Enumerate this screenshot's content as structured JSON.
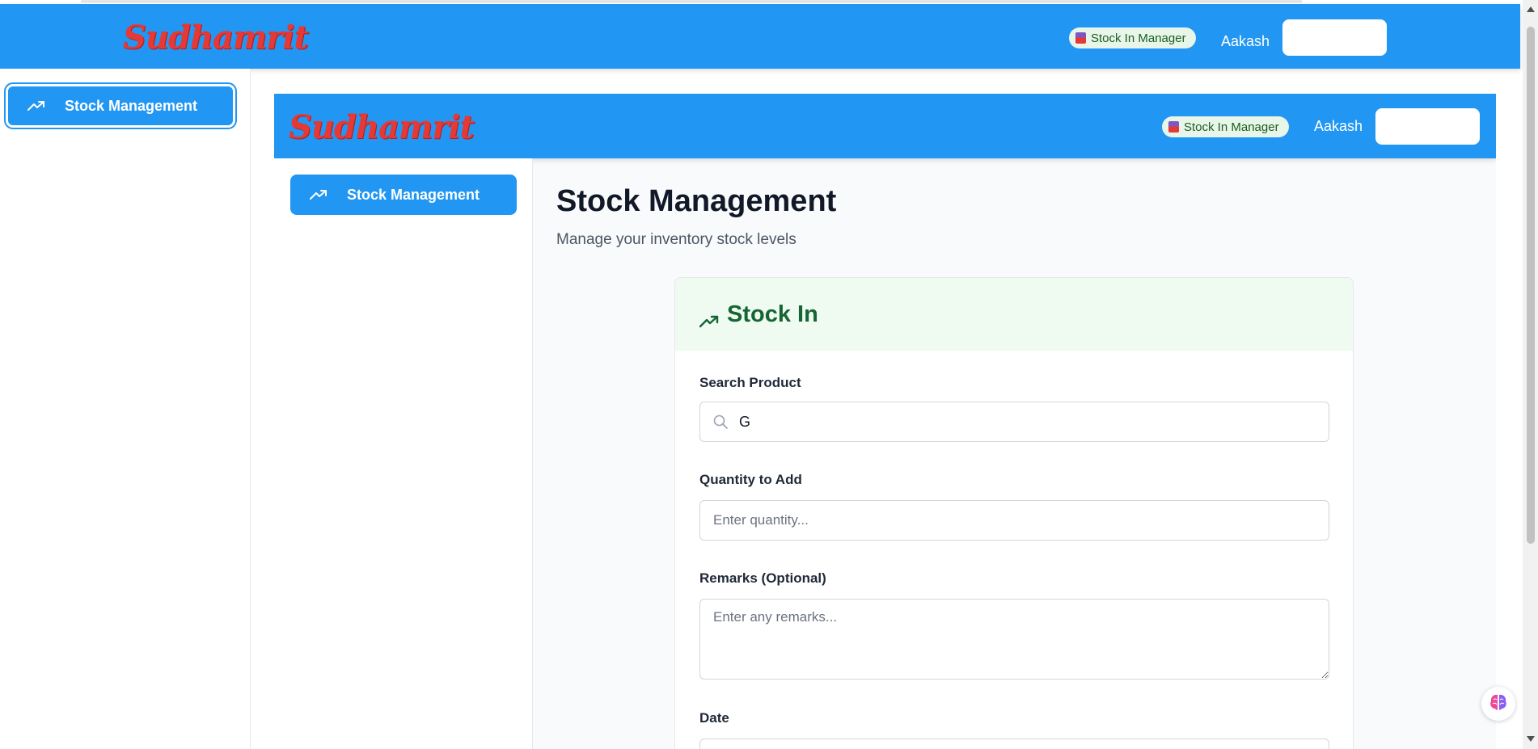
{
  "brand": {
    "logo_text": "Sudhamrit"
  },
  "header": {
    "role_badge": "Stock In Manager",
    "user_name": "Aakash"
  },
  "sidebar": {
    "items": [
      {
        "label": "Stock Management",
        "icon": "trending-up-icon",
        "active": true
      }
    ]
  },
  "page": {
    "title": "Stock Management",
    "subtitle": "Manage your inventory stock levels"
  },
  "stock_in_form": {
    "title": "Stock In",
    "search": {
      "label": "Search Product",
      "value": "G"
    },
    "quantity": {
      "label": "Quantity to Add",
      "placeholder": "Enter quantity..."
    },
    "remarks": {
      "label": "Remarks (Optional)",
      "placeholder": "Enter any remarks..."
    },
    "date": {
      "label": "Date"
    }
  },
  "colors": {
    "primary": "#2196f3",
    "logo": "#e53935",
    "card_header_bg": "#effbf1",
    "card_header_text": "#166534",
    "badge_bg": "#e8f5e9"
  }
}
